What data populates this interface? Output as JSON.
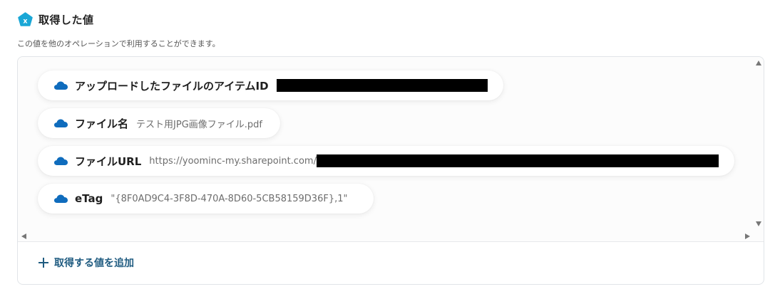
{
  "header": {
    "title": "取得した値",
    "description": "この値を他のオペレーションで利用することができます。",
    "icon": "x-pentagon-icon",
    "icon_color": "#1aa7d6"
  },
  "values": [
    {
      "label": "アップロードしたファイルのアイテムID",
      "value": ""
    },
    {
      "label": "ファイル名",
      "value": "テスト用JPG画像ファイル.pdf"
    },
    {
      "label": "ファイルURL",
      "value": "https://yoominc-my.sharepoint.com/"
    },
    {
      "label": "eTag",
      "value": "\"{8F0AD9C4-3F8D-470A-8D60-5CB58159D36F},1\""
    }
  ],
  "item_icon": "onedrive-cloud-icon",
  "item_icon_color": "#0f6cbd",
  "add_button": {
    "label": "取得する値を追加",
    "color": "#1f5b80"
  }
}
